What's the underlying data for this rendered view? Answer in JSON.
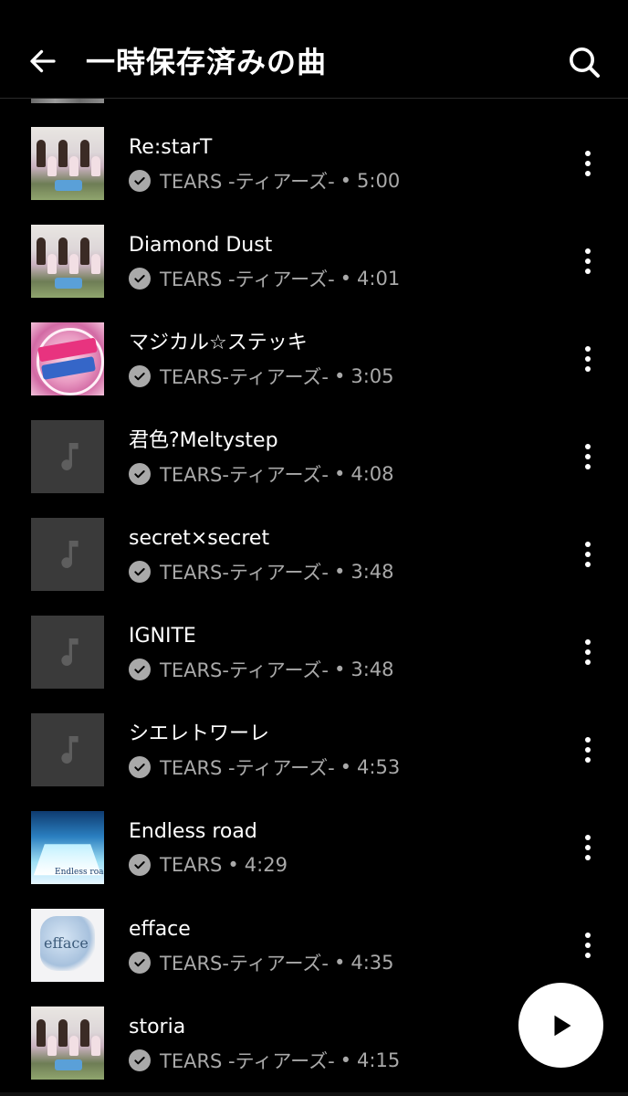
{
  "header": {
    "title": "一時保存済みの曲",
    "back_icon": "arrow-left-icon",
    "search_icon": "search-icon"
  },
  "songs": [
    {
      "title": "Re:starT",
      "artist": "TEARS -ティアーズ-",
      "separator": "•",
      "duration": "5:00",
      "art": "group"
    },
    {
      "title": "Diamond Dust",
      "artist": "TEARS -ティアーズ-",
      "separator": "•",
      "duration": "4:01",
      "art": "group"
    },
    {
      "title": "マジカル☆ステッキ",
      "artist": "TEARS-ティアーズ-",
      "separator": "•",
      "duration": "3:05",
      "art": "magical"
    },
    {
      "title": "君色?Meltystep",
      "artist": "TEARS-ティアーズ-",
      "separator": "•",
      "duration": "4:08",
      "art": "placeholder"
    },
    {
      "title": "secret×secret",
      "artist": "TEARS-ティアーズ-",
      "separator": "•",
      "duration": "3:48",
      "art": "placeholder"
    },
    {
      "title": "IGNITE",
      "artist": "TEARS-ティアーズ-",
      "separator": "•",
      "duration": "3:48",
      "art": "placeholder"
    },
    {
      "title": "シエレトワーレ",
      "artist": "TEARS -ティアーズ-",
      "separator": "•",
      "duration": "4:53",
      "art": "placeholder"
    },
    {
      "title": "Endless road",
      "artist": "TEARS",
      "separator": "•",
      "duration": "4:29",
      "art": "endless"
    },
    {
      "title": "efface",
      "artist": "TEARS-ティアーズ-",
      "separator": "•",
      "duration": "4:35",
      "art": "efface"
    },
    {
      "title": "storia",
      "artist": "TEARS -ティアーズ-",
      "separator": "•",
      "duration": "4:15",
      "art": "group"
    }
  ],
  "art_text": {
    "endless": "Endless road",
    "efface": "efface"
  },
  "fab": {
    "icon": "play-icon"
  },
  "colors": {
    "background": "#000000",
    "secondary_text": "#a9a9a9",
    "placeholder": "#3a3a3a"
  }
}
